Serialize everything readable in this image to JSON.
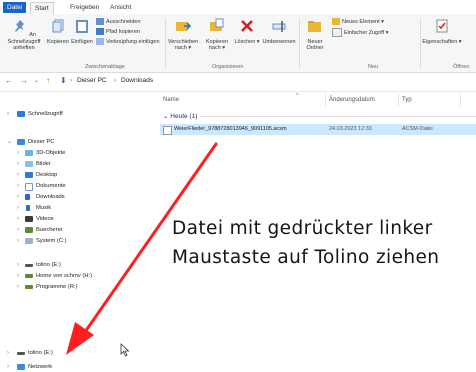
{
  "ribbon_tabs": [
    "Datei",
    "Start",
    "Freigeben",
    "Ansicht"
  ],
  "clipboard": {
    "pin_label": "An Schnellzugriff anheften",
    "copy_label": "Kopieren",
    "paste_label": "Einfügen",
    "cut_label": "Ausschneiden",
    "copy_path_label": "Pfad kopieren",
    "paste_shortcut_label": "Verknüpfung einfügen",
    "group_label": "Zwischenablage"
  },
  "organize": {
    "move_label": "Verschieben nach",
    "copy_to_label": "Kopieren nach",
    "delete_label": "Löschen",
    "rename_label": "Umbenennen",
    "group_label": "Organisieren"
  },
  "new": {
    "new_folder_label": "Neuer Ordner",
    "new_item_label": "Neues Element",
    "easy_access_label": "Einfacher Zugriff",
    "group_label": "Neu"
  },
  "open": {
    "properties_label": "Eigenschaften",
    "group_label": "Öffnen"
  },
  "address": {
    "crumbs": [
      "Dieser PC",
      "Downloads"
    ]
  },
  "nav": {
    "quick_access": "Schnellzugriff",
    "this_pc": "Dieser PC",
    "items": [
      "3D-Objekte",
      "Bilder",
      "Desktop",
      "Dokumente",
      "Downloads",
      "Musik",
      "Videos",
      "Buecherei",
      "System (C:)"
    ],
    "drives": [
      "tolino (E:)",
      "Home von schmv (H:)",
      "Programme (R:)"
    ],
    "tolino_bottom": "tolino (E:)",
    "network": "Netzwerk"
  },
  "columns": [
    "Name",
    "Änderungsdatum",
    "Typ"
  ],
  "group_header": "Heute (1)",
  "file": {
    "name": "WeierFlieder_9788728013946_9091105.acsm",
    "date": "24.03.2023 12:33",
    "type": "ACSM-Datei"
  },
  "annotation": {
    "line1": "Datei mit gedrückter linker",
    "line2": "Maustaste auf Tolino ziehen",
    "color": "#ff1f1f"
  }
}
